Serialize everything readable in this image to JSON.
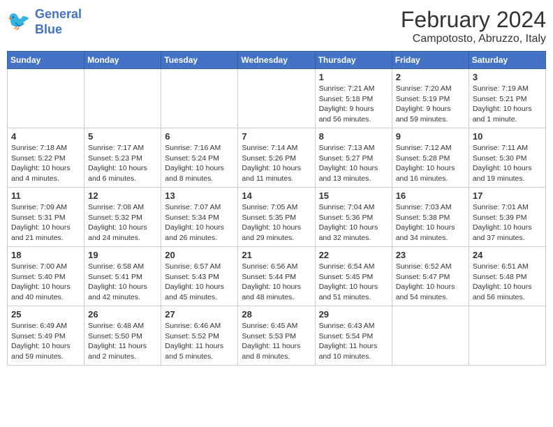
{
  "header": {
    "logo_line1": "General",
    "logo_line2": "Blue",
    "month_title": "February 2024",
    "location": "Campotosto, Abruzzo, Italy"
  },
  "weekdays": [
    "Sunday",
    "Monday",
    "Tuesday",
    "Wednesday",
    "Thursday",
    "Friday",
    "Saturday"
  ],
  "weeks": [
    [
      {
        "day": "",
        "info": ""
      },
      {
        "day": "",
        "info": ""
      },
      {
        "day": "",
        "info": ""
      },
      {
        "day": "",
        "info": ""
      },
      {
        "day": "1",
        "info": "Sunrise: 7:21 AM\nSunset: 5:18 PM\nDaylight: 9 hours and 56 minutes."
      },
      {
        "day": "2",
        "info": "Sunrise: 7:20 AM\nSunset: 5:19 PM\nDaylight: 9 hours and 59 minutes."
      },
      {
        "day": "3",
        "info": "Sunrise: 7:19 AM\nSunset: 5:21 PM\nDaylight: 10 hours and 1 minute."
      }
    ],
    [
      {
        "day": "4",
        "info": "Sunrise: 7:18 AM\nSunset: 5:22 PM\nDaylight: 10 hours and 4 minutes."
      },
      {
        "day": "5",
        "info": "Sunrise: 7:17 AM\nSunset: 5:23 PM\nDaylight: 10 hours and 6 minutes."
      },
      {
        "day": "6",
        "info": "Sunrise: 7:16 AM\nSunset: 5:24 PM\nDaylight: 10 hours and 8 minutes."
      },
      {
        "day": "7",
        "info": "Sunrise: 7:14 AM\nSunset: 5:26 PM\nDaylight: 10 hours and 11 minutes."
      },
      {
        "day": "8",
        "info": "Sunrise: 7:13 AM\nSunset: 5:27 PM\nDaylight: 10 hours and 13 minutes."
      },
      {
        "day": "9",
        "info": "Sunrise: 7:12 AM\nSunset: 5:28 PM\nDaylight: 10 hours and 16 minutes."
      },
      {
        "day": "10",
        "info": "Sunrise: 7:11 AM\nSunset: 5:30 PM\nDaylight: 10 hours and 19 minutes."
      }
    ],
    [
      {
        "day": "11",
        "info": "Sunrise: 7:09 AM\nSunset: 5:31 PM\nDaylight: 10 hours and 21 minutes."
      },
      {
        "day": "12",
        "info": "Sunrise: 7:08 AM\nSunset: 5:32 PM\nDaylight: 10 hours and 24 minutes."
      },
      {
        "day": "13",
        "info": "Sunrise: 7:07 AM\nSunset: 5:34 PM\nDaylight: 10 hours and 26 minutes."
      },
      {
        "day": "14",
        "info": "Sunrise: 7:05 AM\nSunset: 5:35 PM\nDaylight: 10 hours and 29 minutes."
      },
      {
        "day": "15",
        "info": "Sunrise: 7:04 AM\nSunset: 5:36 PM\nDaylight: 10 hours and 32 minutes."
      },
      {
        "day": "16",
        "info": "Sunrise: 7:03 AM\nSunset: 5:38 PM\nDaylight: 10 hours and 34 minutes."
      },
      {
        "day": "17",
        "info": "Sunrise: 7:01 AM\nSunset: 5:39 PM\nDaylight: 10 hours and 37 minutes."
      }
    ],
    [
      {
        "day": "18",
        "info": "Sunrise: 7:00 AM\nSunset: 5:40 PM\nDaylight: 10 hours and 40 minutes."
      },
      {
        "day": "19",
        "info": "Sunrise: 6:58 AM\nSunset: 5:41 PM\nDaylight: 10 hours and 42 minutes."
      },
      {
        "day": "20",
        "info": "Sunrise: 6:57 AM\nSunset: 5:43 PM\nDaylight: 10 hours and 45 minutes."
      },
      {
        "day": "21",
        "info": "Sunrise: 6:56 AM\nSunset: 5:44 PM\nDaylight: 10 hours and 48 minutes."
      },
      {
        "day": "22",
        "info": "Sunrise: 6:54 AM\nSunset: 5:45 PM\nDaylight: 10 hours and 51 minutes."
      },
      {
        "day": "23",
        "info": "Sunrise: 6:52 AM\nSunset: 5:47 PM\nDaylight: 10 hours and 54 minutes."
      },
      {
        "day": "24",
        "info": "Sunrise: 6:51 AM\nSunset: 5:48 PM\nDaylight: 10 hours and 56 minutes."
      }
    ],
    [
      {
        "day": "25",
        "info": "Sunrise: 6:49 AM\nSunset: 5:49 PM\nDaylight: 10 hours and 59 minutes."
      },
      {
        "day": "26",
        "info": "Sunrise: 6:48 AM\nSunset: 5:50 PM\nDaylight: 11 hours and 2 minutes."
      },
      {
        "day": "27",
        "info": "Sunrise: 6:46 AM\nSunset: 5:52 PM\nDaylight: 11 hours and 5 minutes."
      },
      {
        "day": "28",
        "info": "Sunrise: 6:45 AM\nSunset: 5:53 PM\nDaylight: 11 hours and 8 minutes."
      },
      {
        "day": "29",
        "info": "Sunrise: 6:43 AM\nSunset: 5:54 PM\nDaylight: 11 hours and 10 minutes."
      },
      {
        "day": "",
        "info": ""
      },
      {
        "day": "",
        "info": ""
      }
    ]
  ]
}
